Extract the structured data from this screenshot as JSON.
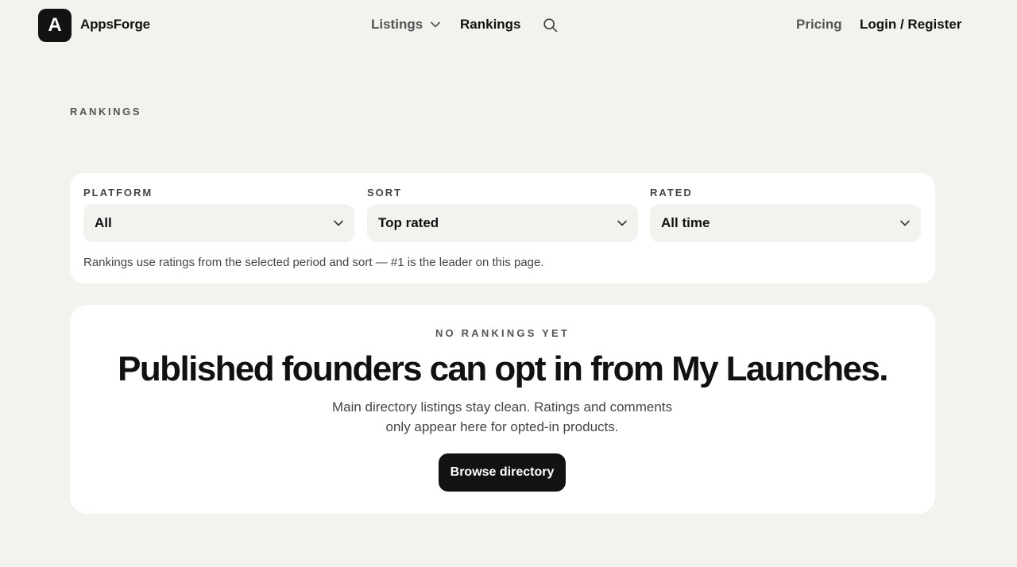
{
  "brand": {
    "logo_letter": "A",
    "name": "AppsForge"
  },
  "nav": {
    "listings": "Listings",
    "rankings": "Rankings",
    "pricing": "Pricing",
    "login": "Login / Register"
  },
  "page": {
    "eyebrow": "RANKINGS"
  },
  "filters": {
    "platform": {
      "label": "PLATFORM",
      "value": "All"
    },
    "sort": {
      "label": "SORT",
      "value": "Top rated"
    },
    "rated": {
      "label": "RATED",
      "value": "All time"
    },
    "note": "Rankings use ratings from the selected period and sort — #1 is the leader on this page."
  },
  "empty_state": {
    "eyebrow": "NO RANKINGS YET",
    "headline": "Published founders can opt in from My Launches.",
    "body": "Main directory listings stay clean. Ratings and comments only appear here for opted-in products.",
    "button": "Browse directory"
  },
  "icons": {
    "listings_dropdown": "chevron-down-icon",
    "search": "search-icon",
    "select_chevron": "chevron-down-icon"
  },
  "colors": {
    "background": "#f2f2ee",
    "card": "#ffffff",
    "primary": "#121212",
    "muted_text": "#555555"
  }
}
